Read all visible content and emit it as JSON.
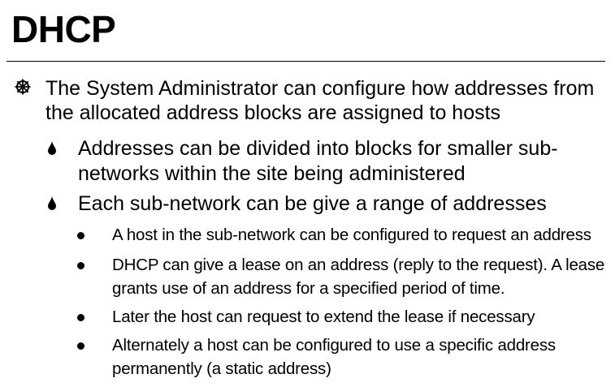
{
  "slide": {
    "title": "DHCP",
    "bullets": {
      "level1": "The System Administrator can configure how addresses from the allocated address blocks are assigned to hosts",
      "level2": [
        "Addresses can be divided into blocks for smaller sub-networks within the site being administered",
        "Each sub-network can be give a range of addresses"
      ],
      "level3": [
        "A host in the sub-network can be configured to request an address",
        "DHCP can give a lease on an address (reply to the request).  A lease grants use of an address for a specified period of time.",
        "Later the host can request to extend the lease if necessary",
        "Alternately a host can be configured to use a specific address permanently (a static address)"
      ]
    }
  },
  "icons": {
    "level1_marker": "wheel-icon",
    "level2_marker": "drop-icon",
    "level3_marker": "disc-icon"
  }
}
